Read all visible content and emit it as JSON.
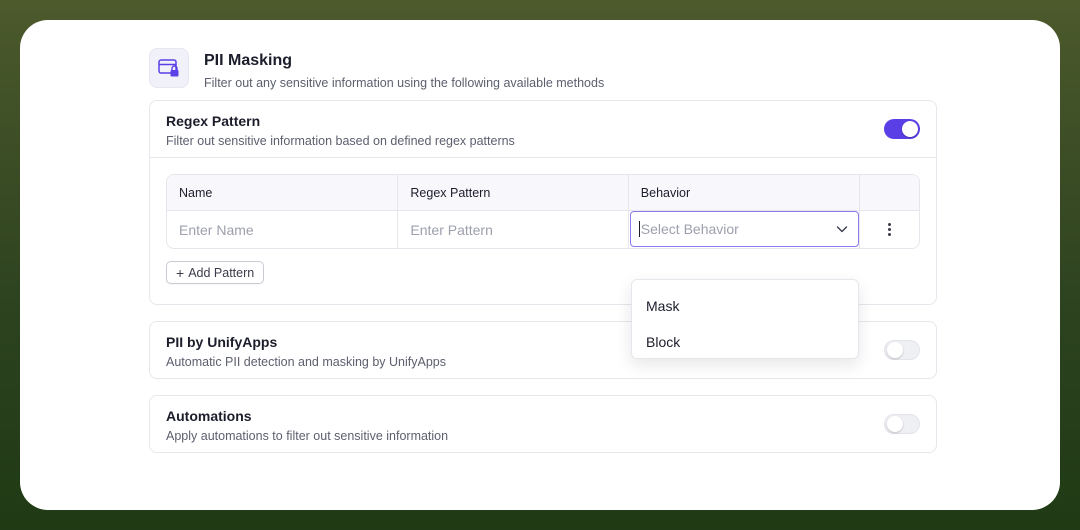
{
  "header": {
    "title": "PII Masking",
    "subtitle": "Filter out any sensitive information using the following available methods",
    "icon": "card-lock-icon"
  },
  "regex": {
    "title": "Regex Pattern",
    "description": "Filter out sensitive information based on defined regex patterns",
    "enabled": true,
    "columns": [
      "Name",
      "Regex Pattern",
      "Behavior"
    ],
    "name_placeholder": "Enter Name",
    "pattern_placeholder": "Enter Pattern",
    "behavior_placeholder": "Select Behavior",
    "behavior_options": [
      "Mask",
      "Block"
    ],
    "add_label": "Add Pattern"
  },
  "unify": {
    "title": "PII by UnifyApps",
    "description": "Automatic PII detection and masking by UnifyApps",
    "enabled": false
  },
  "automations": {
    "title": "Automations",
    "description": "Apply automations to filter out sensitive information",
    "enabled": false
  },
  "colors": {
    "accent": "#5b3fe6",
    "background_top": "#4c5a2c",
    "background_bottom": "#1f3a14"
  }
}
